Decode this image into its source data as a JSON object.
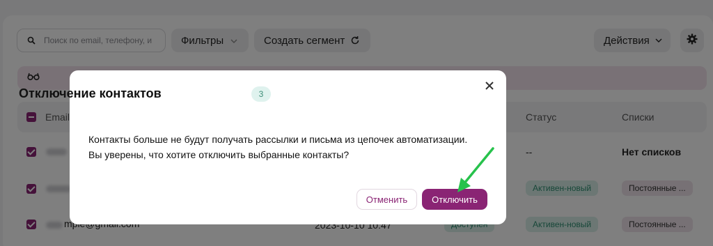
{
  "toolbar": {
    "search_placeholder": "Поиск по email, телефону, и",
    "filters_label": "Фильтры",
    "create_segment_label": "Создать сегмент",
    "actions_label": "Действия"
  },
  "table": {
    "columns": [
      "Email",
      "Статус",
      "Списки"
    ],
    "rows": [
      {
        "email": "",
        "status": "--",
        "lists": "Нет списков"
      },
      {
        "email": "",
        "status": "Активен-новый",
        "lists": "Постоянные ..."
      },
      {
        "email": "mple@gmail.com",
        "date": "2023-10-10 10:47",
        "availability": "Доступен",
        "status": "Активен-новый",
        "lists": "Постоянные ..."
      }
    ]
  },
  "modal": {
    "title": "Отключение контактов",
    "count": "3",
    "body_line1": "Контакты больше не будут получать рассылки и письма из цепочек автоматизации.",
    "body_line2": "Вы уверены, что хотите отключить выбранные контакты?",
    "cancel_label": "Отменить",
    "confirm_label": "Отключить"
  },
  "colors": {
    "accent": "#8a2474",
    "annotation_arrow": "#27c24c",
    "status_green_bg": "#d9efe8"
  }
}
